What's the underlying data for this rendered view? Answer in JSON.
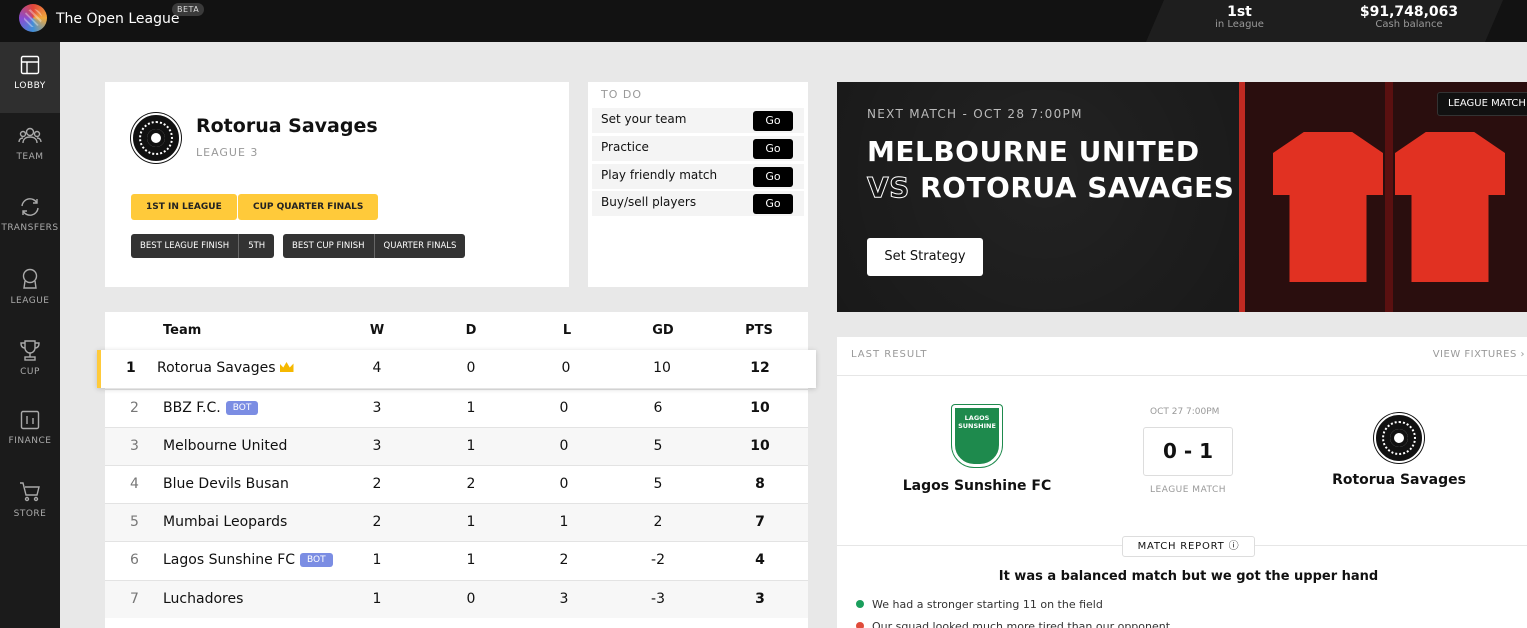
{
  "topbar": {
    "app_title": "The Open League",
    "beta_badge": "BETA",
    "league_position": {
      "value": "1st",
      "label": "in League"
    },
    "cash_balance": {
      "value": "$91,748,063",
      "label": "Cash balance"
    }
  },
  "sidebar": {
    "items": [
      {
        "label": "LOBBY",
        "icon": "lobby-icon"
      },
      {
        "label": "TEAM",
        "icon": "team-icon"
      },
      {
        "label": "TRANSFERS",
        "icon": "transfers-icon"
      },
      {
        "label": "LEAGUE",
        "icon": "league-icon"
      },
      {
        "label": "CUP",
        "icon": "cup-icon"
      },
      {
        "label": "FINANCE",
        "icon": "finance-icon"
      },
      {
        "label": "STORE",
        "icon": "store-icon"
      }
    ]
  },
  "team_card": {
    "name": "Rotorua Savages",
    "league": "LEAGUE 3",
    "badges": [
      "1ST IN LEAGUE",
      "CUP QUARTER FINALS"
    ],
    "records": [
      {
        "label": "BEST LEAGUE FINISH",
        "value": "5TH"
      },
      {
        "label": "BEST CUP FINISH",
        "value": "QUARTER FINALS"
      }
    ]
  },
  "todo": {
    "title": "TO DO",
    "items": [
      {
        "label": "Set your team",
        "action": "Go"
      },
      {
        "label": "Practice",
        "action": "Go"
      },
      {
        "label": "Play friendly match",
        "action": "Go"
      },
      {
        "label": "Buy/sell players",
        "action": "Go"
      }
    ]
  },
  "standings": {
    "headers": {
      "team": "Team",
      "w": "W",
      "d": "D",
      "l": "L",
      "gd": "GD",
      "pts": "PTS"
    },
    "rows": [
      {
        "pos": "1",
        "team": "Rotorua Savages",
        "w": "4",
        "d": "0",
        "l": "0",
        "gd": "10",
        "pts": "12"
      },
      {
        "pos": "2",
        "team": "BBZ F.C.",
        "bot": "BOT",
        "w": "3",
        "d": "1",
        "l": "0",
        "gd": "6",
        "pts": "10"
      },
      {
        "pos": "3",
        "team": "Melbourne United",
        "w": "3",
        "d": "1",
        "l": "0",
        "gd": "5",
        "pts": "10"
      },
      {
        "pos": "4",
        "team": "Blue Devils Busan",
        "w": "2",
        "d": "2",
        "l": "0",
        "gd": "5",
        "pts": "8"
      },
      {
        "pos": "5",
        "team": "Mumbai Leopards",
        "w": "2",
        "d": "1",
        "l": "1",
        "gd": "2",
        "pts": "7"
      },
      {
        "pos": "6",
        "team": "Lagos Sunshine FC",
        "bot": "BOT",
        "w": "1",
        "d": "1",
        "l": "2",
        "gd": "-2",
        "pts": "4"
      },
      {
        "pos": "7",
        "team": "Luchadores",
        "w": "1",
        "d": "0",
        "l": "3",
        "gd": "-3",
        "pts": "3"
      }
    ]
  },
  "next_match": {
    "label": "NEXT MATCH - OCT 28 7:00PM",
    "home": "MELBOURNE UNITED",
    "vs": "VS",
    "away": "ROTORUA SAVAGES",
    "strategy_button": "Set Strategy",
    "match_type": "LEAGUE MATCH"
  },
  "last_result": {
    "title": "LAST RESULT",
    "fixtures_link": "VIEW FIXTURES",
    "home_team": "Lagos Sunshine FC",
    "home_logo_text": "LAGOS SUNSHINE",
    "away_team": "Rotorua Savages",
    "date": "OCT 27 7:00PM",
    "score": "0 - 1",
    "match_type": "LEAGUE MATCH",
    "report_button": "MATCH REPORT",
    "headline": "It was a balanced match but we got the upper hand",
    "bullets": [
      {
        "text": "We had a stronger starting 11 on the field",
        "color": "#1a9e5c"
      },
      {
        "text": "Our squad looked much more tired than our opponent",
        "color": "#e04b3a"
      }
    ]
  },
  "colors": {
    "accent_yellow": "#ffca3a",
    "bot_badge": "#7b8de3",
    "dark": "#121212"
  }
}
